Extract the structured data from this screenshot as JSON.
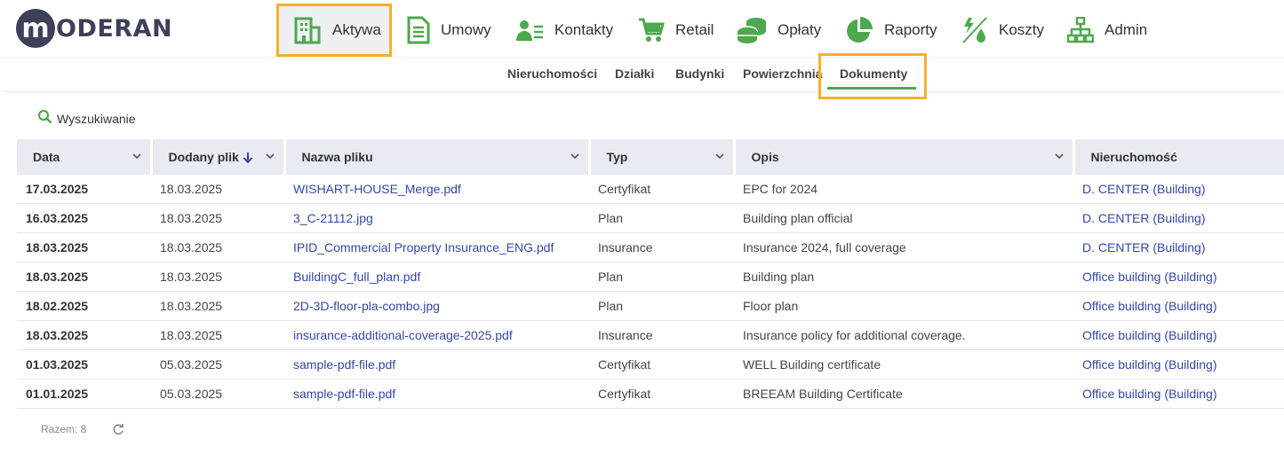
{
  "brand": {
    "logo_letter": "m",
    "logo_text": "ODERAN"
  },
  "nav": [
    {
      "label": "Aktywa",
      "icon": "building-icon",
      "active": true
    },
    {
      "label": "Umowy",
      "icon": "document-icon"
    },
    {
      "label": "Kontakty",
      "icon": "contacts-icon"
    },
    {
      "label": "Retail",
      "icon": "cart-icon"
    },
    {
      "label": "Opłaty",
      "icon": "coins-icon"
    },
    {
      "label": "Raporty",
      "icon": "pie-chart-icon"
    },
    {
      "label": "Koszty",
      "icon": "utility-icon"
    },
    {
      "label": "Admin",
      "icon": "sitemap-icon"
    }
  ],
  "subnav": [
    {
      "label": "Nieruchomości"
    },
    {
      "label": "Działki"
    },
    {
      "label": "Budynki"
    },
    {
      "label": "Powierzchnia"
    },
    {
      "label": "Dokumenty",
      "active": true
    }
  ],
  "search": {
    "label": "Wyszukiwanie"
  },
  "table": {
    "columns": [
      {
        "label": "Data"
      },
      {
        "label": "Dodany plik",
        "sort": "desc"
      },
      {
        "label": "Nazwa pliku"
      },
      {
        "label": "Typ"
      },
      {
        "label": "Opis"
      },
      {
        "label": "Nieruchomość"
      }
    ],
    "rows": [
      [
        "17.03.2025",
        "18.03.2025",
        "WISHART-HOUSE_Merge.pdf",
        "Certyfikat",
        "EPC for 2024",
        "D. CENTER (Building)"
      ],
      [
        "16.03.2025",
        "18.03.2025",
        "3_C-21112.jpg",
        "Plan",
        "Building plan official",
        "D. CENTER (Building)"
      ],
      [
        "18.03.2025",
        "18.03.2025",
        "IPID_Commercial Property Insurance_ENG.pdf",
        "Insurance",
        "Insurance 2024, full coverage",
        "D. CENTER (Building)"
      ],
      [
        "18.03.2025",
        "18.03.2025",
        "BuildingC_full_plan.pdf",
        "Plan",
        "Building plan",
        "Office building (Building)"
      ],
      [
        "18.02.2025",
        "18.03.2025",
        "2D-3D-floor-pla-combo.jpg",
        "Plan",
        "Floor plan",
        "Office building (Building)"
      ],
      [
        "18.03.2025",
        "18.03.2025",
        "insurance-additional-coverage-2025.pdf",
        "Insurance",
        "Insurance policy for additional coverage.",
        "Office building (Building)"
      ],
      [
        "01.03.2025",
        "05.03.2025",
        "sample-pdf-file.pdf",
        "Certyfikat",
        "WELL Building certificate",
        "Office building (Building)"
      ],
      [
        "01.01.2025",
        "05.03.2025",
        "sample-pdf-file.pdf",
        "Certyfikat",
        "BREEAM Building Certificate",
        "Office building (Building)"
      ]
    ]
  },
  "footer": {
    "total": "Razem: 8"
  },
  "colors": {
    "accent": "#4ea84d",
    "highlight": "#f2b12b",
    "link": "#3347a6",
    "brand": "#3d4058"
  }
}
